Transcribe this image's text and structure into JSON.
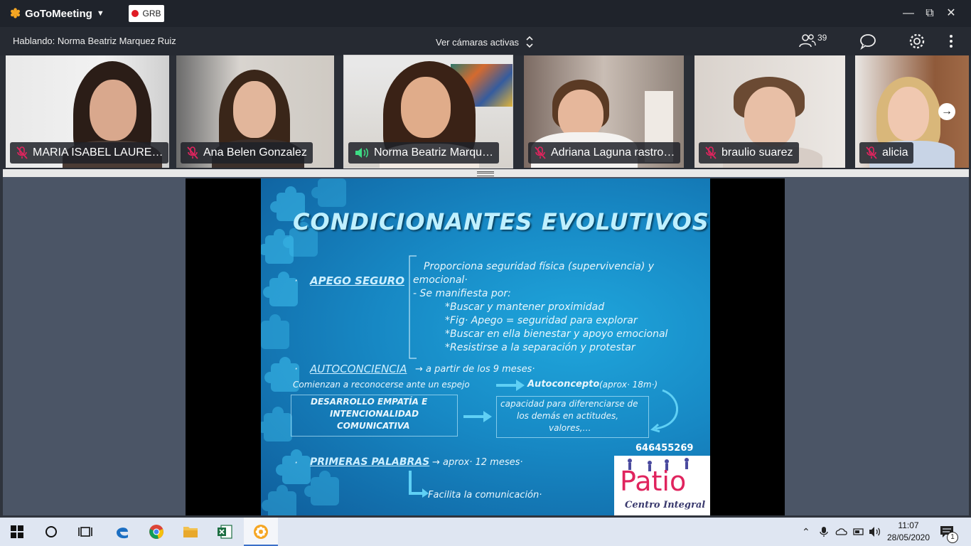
{
  "app": {
    "name": "GoToMeeting",
    "recording_label": "GRB",
    "window_buttons": {
      "minimize": "—",
      "restore": "⧉",
      "close": "✕"
    }
  },
  "infobar": {
    "speaking_text": "Hablando: Norma Beatriz Marquez Ruiz",
    "cameras_label": "Ver cámaras activas",
    "participants_count": "39"
  },
  "participants": [
    {
      "name": "MARIA ISABEL LAURE…",
      "muted": true
    },
    {
      "name": "Ana Belen Gonzalez",
      "muted": true
    },
    {
      "name": "Norma Beatriz Marqu…",
      "muted": false,
      "speaking": true
    },
    {
      "name": "Adriana Laguna rastro…",
      "muted": true
    },
    {
      "name": "braulio suarez",
      "muted": true
    },
    {
      "name": "alicia",
      "muted": true
    }
  ],
  "slide": {
    "title": "CONDICIONANTES EVOLUTIVOS",
    "apego_heading": "APEGO SEGURO",
    "apego_line1": "Proporciona seguridad física (supervivencia) y",
    "apego_line2": "emocional·",
    "apego_line3": "- Se manifiesta por:",
    "apego_items": [
      "*Buscar y mantener proximidad",
      "*Fig· Apego = seguridad para explorar",
      "*Buscar en ella bienestar y apoyo emocional",
      "*Resistirse a la separación y protestar"
    ],
    "autoconciencia_heading": "AUTOCONCIENCIA",
    "autoconciencia_text": "→ a partir de los 9 meses·",
    "espejo_text": "Comienzan a reconocerse ante un espejo",
    "autoconcepto_label": "Autoconcepto",
    "autoconcepto_note": "(aprox· 18m·)",
    "empatia_lines": [
      "DESARROLLO EMPATÍA E",
      "INTENCIONALIDAD",
      "COMUNICATIVA"
    ],
    "capacidad_lines": [
      "capacidad para diferenciarse de",
      "los demás en actitudes,",
      "valores,…"
    ],
    "phone": "646455269",
    "palabras_heading": "PRIMERAS PALABRAS",
    "palabras_text": "→ aprox· 12 meses·",
    "facilita_text": "Facilita la comunicación·",
    "logo_main": "Patio",
    "logo_sub": "Centro Integral"
  },
  "taskbar": {
    "time": "11:07",
    "date": "28/05/2020",
    "notification_count": "1"
  },
  "colors": {
    "slide_bg": "#1788c4",
    "accent_record": "#e01b24",
    "speaking_green": "#3ddc84",
    "muted_red": "#e0245e"
  }
}
